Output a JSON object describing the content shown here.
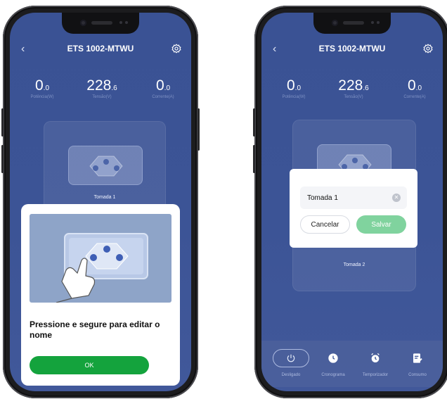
{
  "left_screen": {
    "title": "ETS 1002-MTWU",
    "back_glyph": "‹",
    "readings": [
      {
        "int": "0",
        "dec": ".0",
        "label": "Potência(W)"
      },
      {
        "int": "228",
        "dec": ".6",
        "label": "Tensão(V)"
      },
      {
        "int": "0",
        "dec": ".0",
        "label": "Corrente(A)"
      }
    ],
    "socket_label": "Tomada 1",
    "sheet": {
      "message": "Pressione e segure para editar o nome",
      "ok_label": "OK"
    }
  },
  "right_screen": {
    "title": "ETS 1002-MTWU",
    "back_glyph": "‹",
    "readings": [
      {
        "int": "0",
        "dec": ".0",
        "label": "Potência(W)"
      },
      {
        "int": "228",
        "dec": ".6",
        "label": "Tensão(V)"
      },
      {
        "int": "0",
        "dec": ".0",
        "label": "Corrente(A)"
      }
    ],
    "socket_label": "Tomada 2",
    "dialog": {
      "input_value": "Tomada 1",
      "cancel_label": "Cancelar",
      "save_label": "Salvar"
    },
    "nav": [
      {
        "label": "Desligado",
        "icon": "power-icon"
      },
      {
        "label": "Cronograma",
        "icon": "clock-icon"
      },
      {
        "label": "Temporizador",
        "icon": "alarm-icon"
      },
      {
        "label": "Consumo",
        "icon": "report-icon"
      }
    ]
  },
  "colors": {
    "screen_bg": "#3b5395",
    "ok_green": "#14a33d",
    "save_green": "#80d39e"
  }
}
